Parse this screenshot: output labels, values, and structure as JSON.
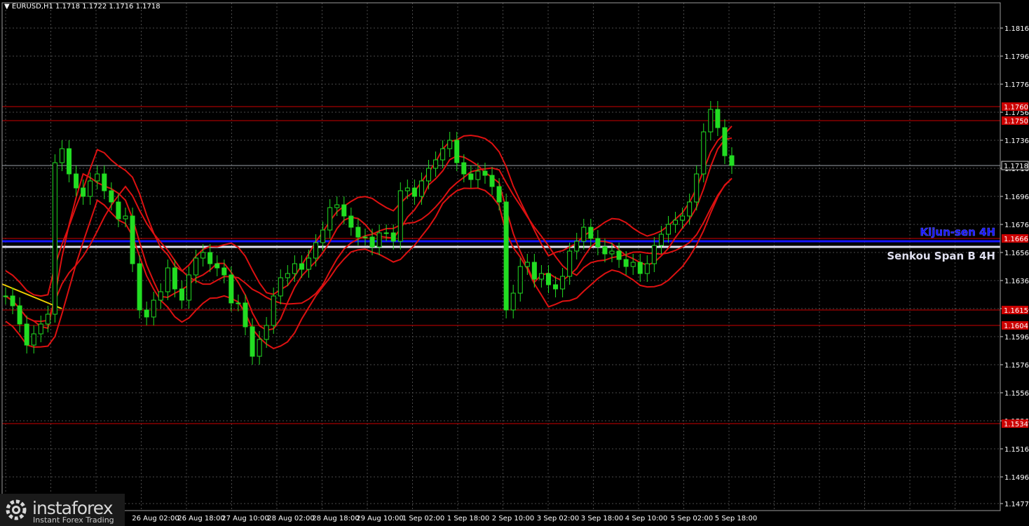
{
  "title": {
    "symbol": "EURUSD,H1",
    "ohlc": "1.1718 1.1722 1.1716 1.1718"
  },
  "watermark": {
    "brand": "instaforex",
    "tagline": "Instant Forex Trading",
    "icon": "instaforex-gear-logo"
  },
  "colors": {
    "background": "#000000",
    "grid": "#4a4a4a",
    "candles": "#22dd22",
    "ichimoku_lines": "#dd1111",
    "level_lines": "#cc0000",
    "kijun": "#1515ff",
    "senkou": "#e0e0f0",
    "trendline": "#f0d000"
  },
  "chart_data": {
    "type": "line",
    "timeframe": "H1",
    "y_ticks": [
      "1.1816",
      "1.1796",
      "1.1776",
      "1.1756",
      "1.1736",
      "1.1716",
      "1.1696",
      "1.1676",
      "1.1656",
      "1.1636",
      "1.1616",
      "1.1596",
      "1.1576",
      "1.1556",
      "1.1536",
      "1.1516",
      "1.1496",
      "1.1477"
    ],
    "x_ticks": [
      "26 Aug 02:00",
      "26 Aug 18:00",
      "27 Aug 10:00",
      "28 Aug 02:00",
      "28 Aug 18:00",
      "29 Aug 10:00",
      "1 Sep 02:00",
      "1 Sep 18:00",
      "2 Sep 10:00",
      "3 Sep 02:00",
      "3 Sep 18:00",
      "4 Sep 10:00",
      "5 Sep 02:00",
      "5 Sep 18:00"
    ],
    "ylim": [
      1.147,
      1.183
    ],
    "current_price": "1.1718",
    "levels": [
      {
        "label": "1.1760",
        "value": 1.176
      },
      {
        "label": "1.1750",
        "value": 1.175
      },
      {
        "label": "1.1666",
        "value": 1.1666
      },
      {
        "label": "1.1615",
        "value": 1.1615
      },
      {
        "label": "1.1604",
        "value": 1.1604
      },
      {
        "label": "1.1534",
        "value": 1.1534
      }
    ],
    "indicator_lines": [
      {
        "name": "Kijun-sen 4H",
        "value": 1.1664
      },
      {
        "name": "Senkou Span B 4H",
        "value": 1.166
      }
    ],
    "close_path": [
      1.1625,
      1.1618,
      1.1605,
      1.159,
      1.1598,
      1.1605,
      1.1612,
      1.172,
      1.173,
      1.1712,
      1.1702,
      1.1696,
      1.1707,
      1.1712,
      1.17,
      1.1692,
      1.168,
      1.1682,
      1.1648,
      1.1615,
      1.161,
      1.1622,
      1.1628,
      1.1645,
      1.163,
      1.1622,
      1.164,
      1.1652,
      1.1656,
      1.1648,
      1.1645,
      1.164,
      1.162,
      1.162,
      1.1603,
      1.1582,
      1.1594,
      1.1604,
      1.1625,
      1.1638,
      1.1641,
      1.1648,
      1.1644,
      1.1652,
      1.1663,
      1.1672,
      1.1688,
      1.169,
      1.1682,
      1.1674,
      1.1667,
      1.1667,
      1.166,
      1.167,
      1.167,
      1.1664,
      1.17,
      1.1702,
      1.1696,
      1.1707,
      1.1716,
      1.1722,
      1.173,
      1.1736,
      1.172,
      1.1712,
      1.1708,
      1.1714,
      1.1711,
      1.1703,
      1.1692,
      1.1615,
      1.1627,
      1.1646,
      1.1649,
      1.1637,
      1.1641,
      1.1633,
      1.163,
      1.1639,
      1.1657,
      1.1664,
      1.1674,
      1.1666,
      1.166,
      1.1655,
      1.1657,
      1.1651,
      1.1646,
      1.1649,
      1.1641,
      1.1648,
      1.1661,
      1.1669,
      1.1676,
      1.1679,
      1.1682,
      1.1692,
      1.1712,
      1.1742,
      1.1758,
      1.1745,
      1.1725,
      1.1718
    ]
  }
}
